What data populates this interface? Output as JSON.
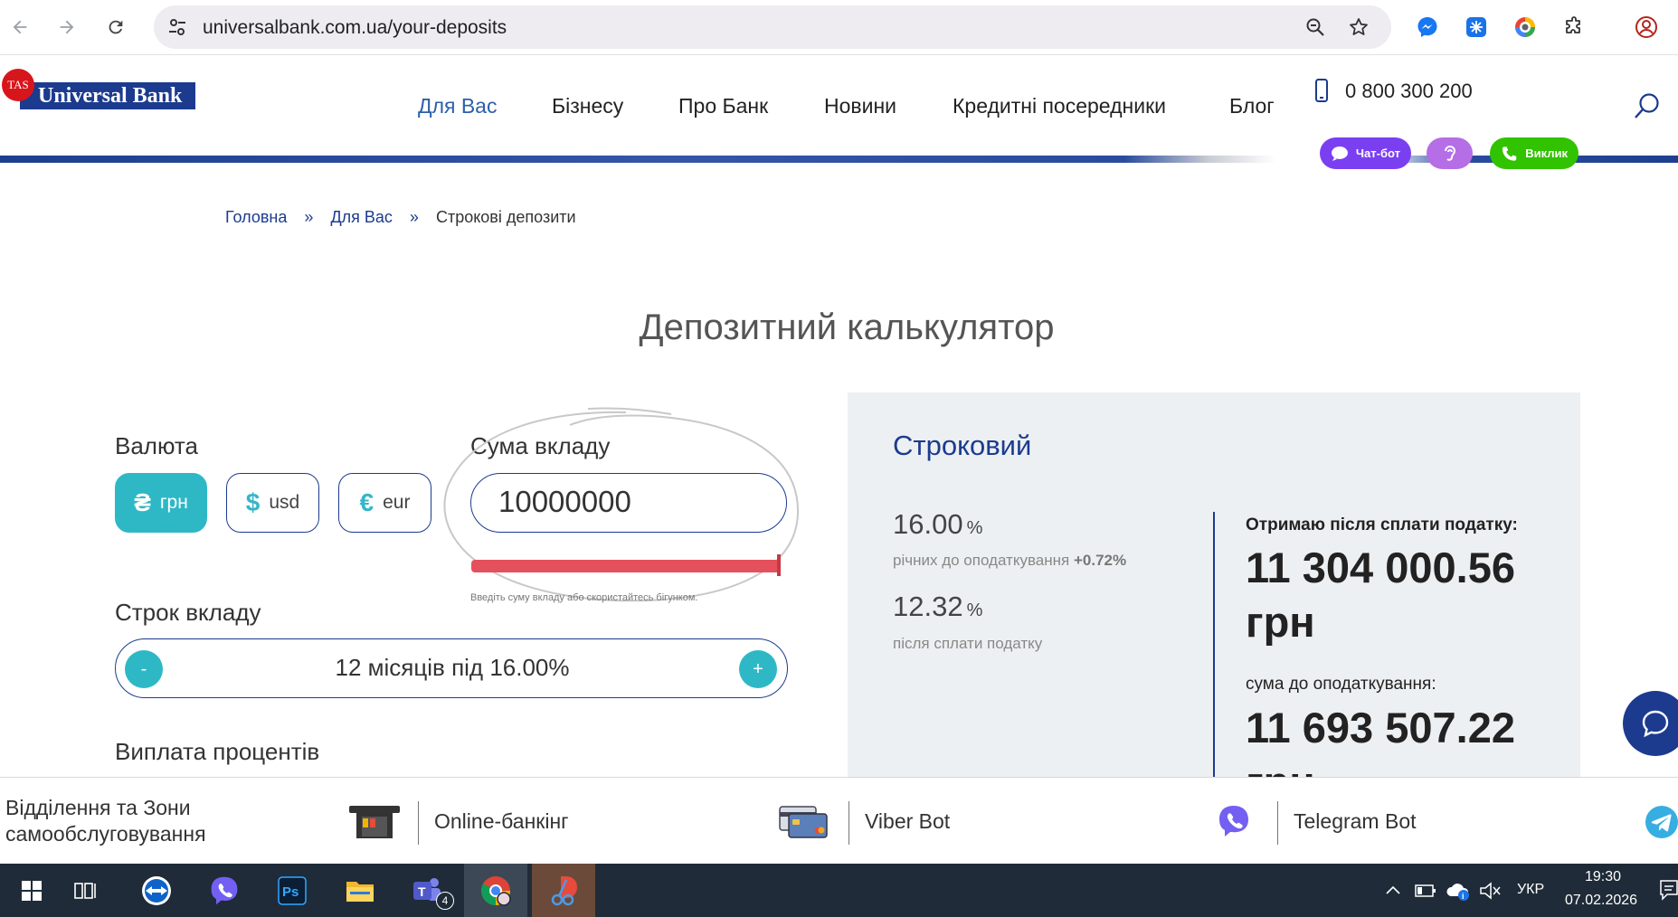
{
  "browser": {
    "url": "universalbank.com.ua/your-deposits"
  },
  "site": {
    "logo_badge": "TAS",
    "logo_text": "Universal Bank",
    "menu": [
      {
        "label": "Для Вас"
      },
      {
        "label": "Бізнесу"
      },
      {
        "label": "Про Банк"
      },
      {
        "label": "Новини"
      },
      {
        "label": "Кредитні посередники"
      },
      {
        "label": "Блог"
      }
    ],
    "phone": "0 800 300 200",
    "pills": {
      "chatbot": "Чат-бот",
      "call": "Виклик"
    },
    "colors": {
      "brand": "#1c3b8f",
      "accent": "#2eb8c6",
      "logo_red": "#d7161c",
      "slider": "#e5505d",
      "chatbot_pill": "#7b3ff2",
      "call_pill": "#31c200"
    }
  },
  "breadcrumb": {
    "home": "Головна",
    "section": "Для Вас",
    "current": "Строкові депозити"
  },
  "calculator": {
    "title": "Депозитний калькулятор",
    "currency_label": "Валюта",
    "currencies": [
      {
        "symbol": "₴",
        "code": "грн",
        "active": true
      },
      {
        "symbol": "$",
        "code": "usd",
        "active": false
      },
      {
        "symbol": "€",
        "code": "eur",
        "active": false
      }
    ],
    "amount_label": "Сума вкладу",
    "amount_value": "10000000",
    "amount_slider_fraction": 1.0,
    "amount_hint": "Введіть суму вкладу або скористайтесь бігунком.",
    "term_label": "Строк вкладу",
    "term_minus": "-",
    "term_plus": "+",
    "term_text": "12 місяців під 16.00%",
    "interest_label": "Виплата процентів"
  },
  "result": {
    "title": "Строковий",
    "rate_gross": "16.00",
    "pct_sign": "%",
    "rate_gross_caption": "річних до оподаткування",
    "rate_gross_bonus": "+0.72%",
    "rate_net": "12.32",
    "rate_net_caption": "після сплати податку",
    "net_label": "Отримаю після сплати податку:",
    "net_amount": "11 304 000.56",
    "net_currency": "грн",
    "gross_label": "сума до оподаткування:",
    "gross_amount": "11 693 507.22",
    "gross_currency": "грн"
  },
  "bottom_bar": {
    "branches": "Відділення та Зони самообслуговування",
    "online_banking": "Online-банкінг",
    "viber_bot": "Viber Bot",
    "telegram_bot": "Telegram Bot"
  },
  "taskbar": {
    "teams_badge": "4",
    "language": "УКР",
    "time": "19:30",
    "date": "07.02.2026"
  }
}
